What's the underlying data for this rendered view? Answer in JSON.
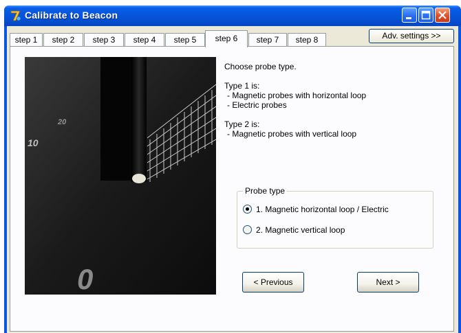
{
  "window": {
    "title": "Calibrate to Beacon"
  },
  "tabs": [
    "step 1",
    "step 2",
    "step 3",
    "step 4",
    "step 5",
    "step 6",
    "step 7",
    "step 8"
  ],
  "active_tab_index": 5,
  "adv_settings_label": "Adv. settings >>",
  "info": {
    "prompt": "Choose probe type.",
    "type1_heading": "Type 1 is:",
    "type1_items": [
      "- Magnetic probes with horizontal loop",
      "- Electric probes"
    ],
    "type2_heading": "Type 2 is:",
    "type2_items": [
      "- Magnetic probes with vertical loop"
    ]
  },
  "probe_type": {
    "legend": "Probe type",
    "options": [
      "1. Magnetic horizontal loop / Electric",
      "2. Magnetic vertical loop"
    ],
    "selected_index": 0
  },
  "buttons": {
    "previous": "< Previous",
    "next": "Next >"
  },
  "photo": {
    "scale_labels": [
      "10",
      "20",
      "0"
    ]
  },
  "colors": {
    "titlebar": "#0a55e2",
    "dialog": "#ece9d8",
    "panel": "#fcfcfe",
    "close_button": "#e0502a"
  }
}
